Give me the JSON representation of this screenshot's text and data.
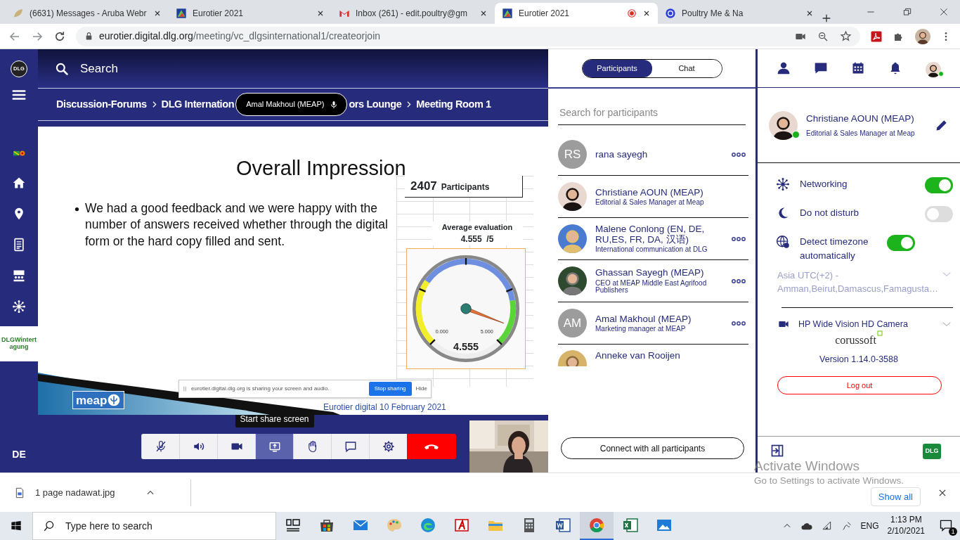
{
  "browser": {
    "tabs": [
      {
        "kind": "leaf",
        "title": "(6631) Messages - Aruba Webr",
        "selected": false,
        "recording": false
      },
      {
        "kind": "logo",
        "title": "Eurotier 2021",
        "selected": false,
        "recording": false
      },
      {
        "kind": "mail",
        "title": "Inbox (261) - edit.poultry@gm",
        "selected": false,
        "recording": false
      },
      {
        "kind": "logo",
        "title": "Eurotier 2021",
        "selected": true,
        "recording": true
      },
      {
        "kind": "globe",
        "title": "Poultry Me & Na",
        "selected": false,
        "recording": false
      }
    ],
    "url": {
      "host": "eurotier.digital.dlg.org",
      "path": "/meeting/vc_dlgsinternational1/createorjoin"
    }
  },
  "sidebar": {
    "logo": "DLG",
    "event_logo": "DLGWintertagung",
    "language": "DE"
  },
  "search": {
    "placeholder": "Search"
  },
  "breadcrumb": [
    {
      "kind": "crumb",
      "text": "Discussion-Forums",
      "chevron_before": false
    },
    {
      "kind": "crumb",
      "text": "DLG Internation",
      "chevron_before": true
    },
    {
      "kind": "speaker",
      "text": "Amal Makhoul (MEAP)"
    },
    {
      "kind": "crumb",
      "text": "ors Lounge",
      "chevron_before": false
    },
    {
      "kind": "crumb",
      "text": "Meeting Room 1",
      "chevron_before": true
    }
  ],
  "slide": {
    "title": "Overall Impression",
    "bullets": [
      "We had a good feedback and we were happy with the number of answers received whether through the digital form or the hard copy filled and sent."
    ],
    "participants_count": "2407",
    "participants_label": "Participants",
    "evaluation_label": "Average evaluation",
    "evaluation_value": "4.555  /5",
    "gauge": {
      "min": "0.000",
      "max": "5.000",
      "reading": "4.555"
    },
    "share_notice": {
      "text": "eurotier.digital.dlg.org is sharing your screen and audio.",
      "stop": "Stop sharing",
      "hide": "Hide"
    },
    "logo": "meap",
    "footer": "Eurotier digital 10 February 2021"
  },
  "call_controls": {
    "tooltip": "Start share screen",
    "buttons": [
      {
        "kind": "mic-off",
        "active": false
      },
      {
        "kind": "speaker",
        "active": false
      },
      {
        "kind": "camera",
        "active": false
      },
      {
        "kind": "share",
        "active": true
      },
      {
        "kind": "hand",
        "active": false
      },
      {
        "kind": "chat",
        "active": false
      },
      {
        "kind": "settings",
        "active": false
      },
      {
        "kind": "hangup",
        "active": false
      }
    ]
  },
  "participants_panel": {
    "tabs": [
      {
        "label": "Participants",
        "selected": true
      },
      {
        "label": "Chat",
        "selected": false
      }
    ],
    "search": {
      "placeholder": "Search for participants"
    },
    "participants": [
      {
        "kind": "initials",
        "initials": "RS",
        "name": "rana sayegh",
        "menu": true
      },
      {
        "name": "Christiane AOUN (MEAP)",
        "title": "Editorial & Sales Manager at Meap",
        "menu": false
      },
      {
        "name": "Malene Conlong (EN, DE, RU,ES, FR, DA, 汉语)",
        "title": "International communication at DLG",
        "menu": true
      },
      {
        "name": "Ghassan Sayegh (MEAP)",
        "title": "CEO at MEAP Middle East Agrifood Publishers",
        "menu": true
      },
      {
        "kind": "initials",
        "initials": "AM",
        "name": "Amal Makhoul (MEAP)",
        "title": "Marketing manager at MEAP",
        "menu": true
      },
      {
        "name": "Anneke van Rooijen",
        "menu": false
      }
    ],
    "connect_button": "Connect with all participants"
  },
  "user_panel": {
    "profile": {
      "name": "Christiane AOUN (MEAP)",
      "title": "Editorial & Sales Manager at Meap",
      "online": true
    },
    "settings": [
      {
        "kind": "networking",
        "label": "Networking",
        "on": true
      },
      {
        "kind": "dnd",
        "label": "Do not disturb",
        "on": false
      },
      {
        "kind": "timezone",
        "label": "Detect timezone automatically",
        "on": true
      }
    ],
    "timezone": {
      "value": "Asia UTC(+2) - Amman,Beirut,Damascus,Famagusta…",
      "disabled": true
    },
    "camera": {
      "value": "HP Wide Vision HD Camera"
    },
    "brand": "corussoft",
    "version": "Version 1.14.0-3588",
    "logout": "Log out",
    "bottom_logo": "DLG"
  },
  "downloads": {
    "file": "1 page nadawat.jpg",
    "show_all": "Show all"
  },
  "windows_notice": {
    "title": "Activate Windows",
    "text": "Go to Settings to activate Windows."
  },
  "taskbar": {
    "search": {
      "placeholder": "Type here to search"
    },
    "apps": [
      {
        "kind": "taskview",
        "active": false
      },
      {
        "kind": "store",
        "active": false
      },
      {
        "kind": "mail",
        "active": false
      },
      {
        "kind": "paint",
        "active": false
      },
      {
        "kind": "edge",
        "active": false
      },
      {
        "kind": "pdf",
        "active": false
      },
      {
        "kind": "explorer",
        "active": false
      },
      {
        "kind": "calculator",
        "active": false
      },
      {
        "kind": "word",
        "active": false
      },
      {
        "kind": "chrome",
        "active": true
      },
      {
        "kind": "excel",
        "active": false
      },
      {
        "kind": "photos",
        "active": false
      }
    ],
    "language": "ENG",
    "time": "1:13 PM",
    "date": "2/10/2021",
    "notifications": "1"
  }
}
